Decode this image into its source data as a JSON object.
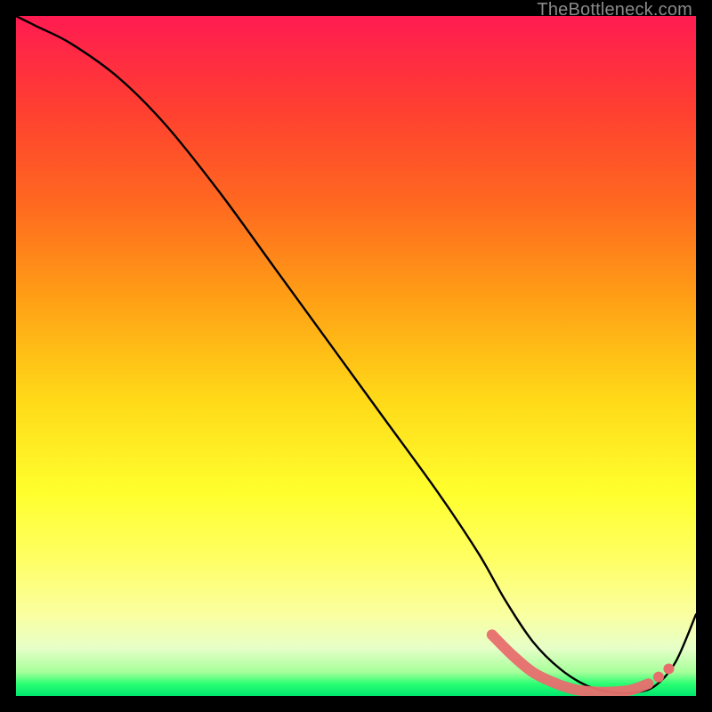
{
  "attribution": "TheBottleneck.com",
  "colors": {
    "curve": "#000000",
    "highlight": "#e86e6e",
    "gradient_top": "#ff1b51",
    "gradient_bottom": "#00e66e"
  },
  "chart_data": {
    "type": "line",
    "title": "",
    "xlabel": "",
    "ylabel": "",
    "xlim": [
      0,
      100
    ],
    "ylim": [
      0,
      100
    ],
    "grid": false,
    "series": [
      {
        "name": "curve",
        "x": [
          0,
          3,
          8,
          15,
          22,
          30,
          38,
          46,
          54,
          62,
          68,
          72,
          76,
          80,
          84,
          88,
          91,
          94,
          97,
          100
        ],
        "y": [
          100,
          98.5,
          96,
          91,
          84,
          74,
          63,
          52,
          41,
          30,
          21,
          14,
          8,
          4,
          1.5,
          0.5,
          0.5,
          1.5,
          5,
          12
        ]
      }
    ],
    "highlight_segment": {
      "x": [
        70,
        73,
        76,
        79,
        82,
        85,
        88,
        90.5,
        93
      ],
      "y": [
        9,
        6,
        3.5,
        2,
        1,
        0.6,
        0.6,
        0.9,
        1.8
      ]
    },
    "highlight_dots": {
      "x": [
        94.5,
        96
      ],
      "y": [
        2.8,
        4.0
      ]
    }
  }
}
